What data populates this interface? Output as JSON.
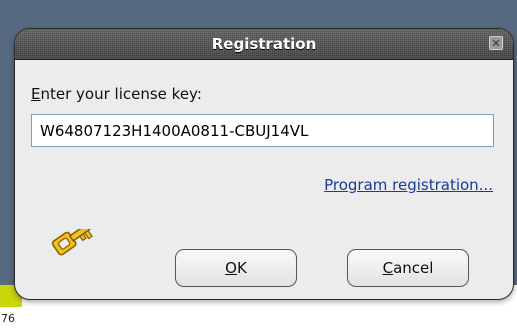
{
  "dialog": {
    "title": "Registration",
    "close_glyph": "✕",
    "label_mnemonic": "E",
    "label_rest": "nter your license key:",
    "license_key_value": "W64807123H1400A0811-CBUJ14VL",
    "registration_link": "Program registration...",
    "ok_mnemonic": "O",
    "ok_rest": "K",
    "cancel_mnemonic": "C",
    "cancel_rest": "ancel",
    "icon": "key-icon"
  },
  "background": {
    "partial_text": "76"
  },
  "colors": {
    "desktop": "#566a82",
    "accent_strip": "#c9d60d",
    "link": "#1a3a9a",
    "titlebar": "#4a4a4a"
  }
}
